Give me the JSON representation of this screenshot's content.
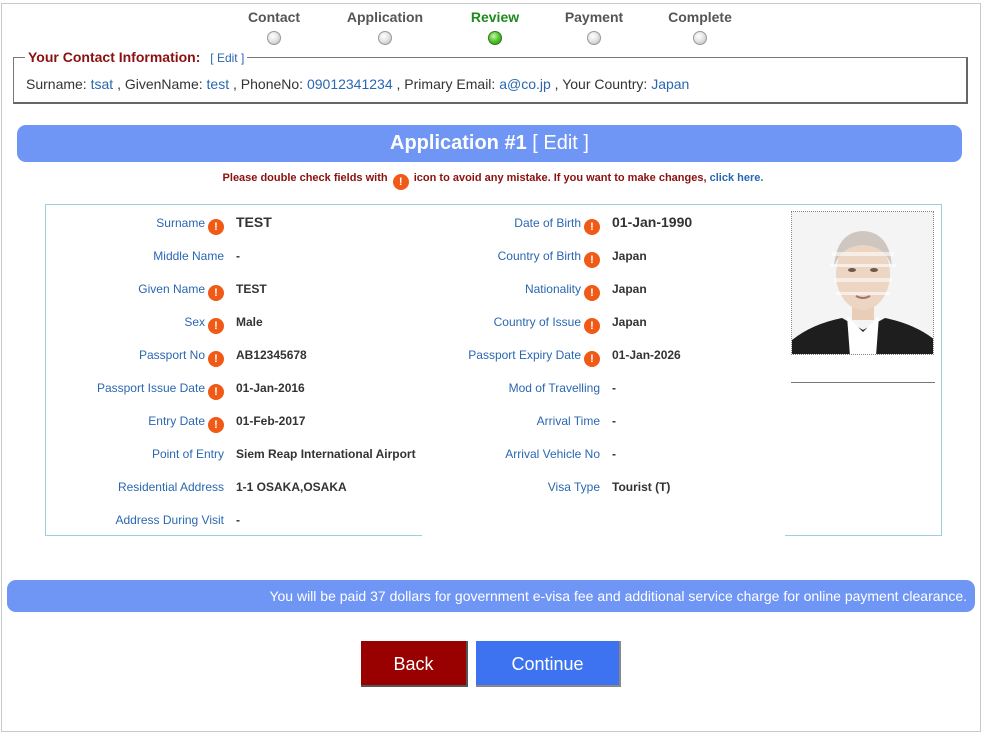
{
  "steps": [
    {
      "label": "Contact",
      "active": false
    },
    {
      "label": "Application",
      "active": false
    },
    {
      "label": "Review",
      "active": true
    },
    {
      "label": "Payment",
      "active": false
    },
    {
      "label": "Complete",
      "active": false
    }
  ],
  "contact": {
    "legend_title": "Your Contact Information:",
    "legend_edit": "[ Edit ]",
    "surname_label": "Surname:",
    "surname": "tsat",
    "given_label": ", GivenName:",
    "given": "test",
    "phone_label": ", PhoneNo:",
    "phone": "09012341234",
    "email_label": ", Primary Email:",
    "email": "a@co.jp",
    "country_label": ", Your Country:",
    "country": "Japan"
  },
  "application": {
    "title": "Application #1",
    "edit": "[ Edit ]"
  },
  "notice": {
    "before": "Please double check fields with",
    "after": "icon to avoid any mistake. If you want to make changes,",
    "link": "click here."
  },
  "left_fields": [
    {
      "label": "Surname",
      "value": "TEST",
      "warn": true,
      "big": true
    },
    {
      "label": "Middle Name",
      "value": "-",
      "warn": false
    },
    {
      "label": "Given Name",
      "value": "TEST",
      "warn": true
    },
    {
      "label": "Sex",
      "value": "Male",
      "warn": true
    },
    {
      "label": "Passport No",
      "value": "AB12345678",
      "warn": true
    },
    {
      "label": "Passport Issue Date",
      "value": "01-Jan-2016",
      "warn": true
    },
    {
      "label": "Entry Date",
      "value": "01-Feb-2017",
      "warn": true
    },
    {
      "label": "Point of Entry",
      "value": "Siem Reap International Airport",
      "warn": false
    },
    {
      "label": "Residential Address",
      "value": "1-1 OSAKA,OSAKA",
      "warn": false
    },
    {
      "label": "Address During Visit",
      "value": "-",
      "warn": false
    }
  ],
  "right_fields": [
    {
      "label": "Date of Birth",
      "value": "01-Jan-1990",
      "warn": true,
      "big": true
    },
    {
      "label": "Country of Birth",
      "value": "Japan",
      "warn": true
    },
    {
      "label": "Nationality",
      "value": "Japan",
      "warn": true
    },
    {
      "label": "Country of Issue",
      "value": "Japan",
      "warn": true
    },
    {
      "label": "Passport Expiry Date",
      "value": "01-Jan-2026",
      "warn": true
    },
    {
      "label": "Mod of Travelling",
      "value": "-",
      "warn": false
    },
    {
      "label": "Arrival Time",
      "value": "-",
      "warn": false
    },
    {
      "label": "Arrival Vehicle No",
      "value": "-",
      "warn": false
    },
    {
      "label": "Visa Type",
      "value": "Tourist (T)",
      "warn": false
    }
  ],
  "warn_icon": "!",
  "fee_notice": "You will be paid 37 dollars for government e-visa fee and additional service charge for online payment clearance.",
  "buttons": {
    "back": "Back",
    "continue": "Continue"
  },
  "colors": {
    "banner": "#6f95f5",
    "back_button": "#990000",
    "continue_button": "#3d73f0",
    "warn": "#f05a16",
    "link": "#2a67b1",
    "legend": "#8b1010"
  }
}
